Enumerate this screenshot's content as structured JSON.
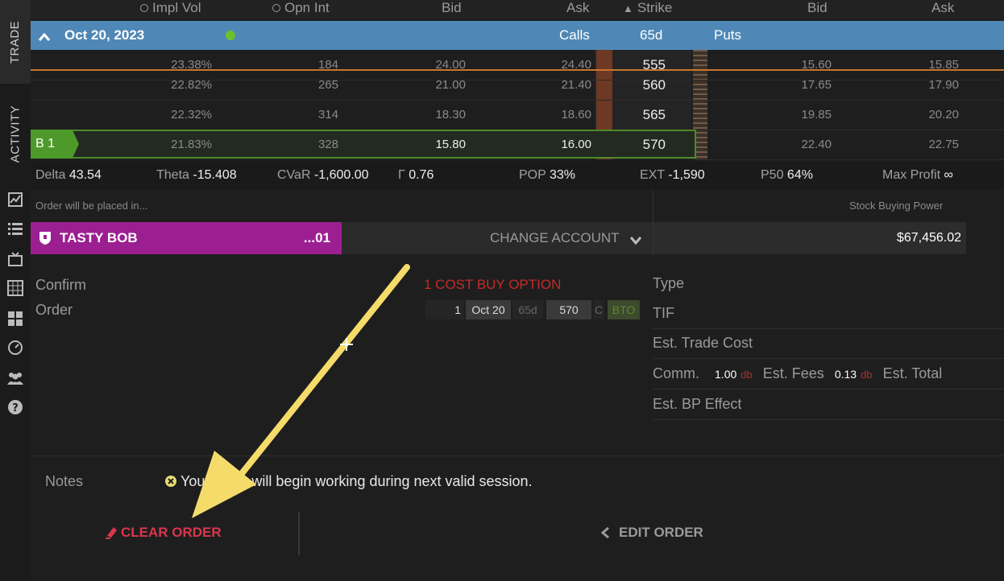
{
  "sidebar": {
    "tabs": [
      {
        "label": "TRADE"
      },
      {
        "label": "ACTIVITY"
      }
    ],
    "icons": [
      "chart-icon",
      "list-icon",
      "tv-icon",
      "grid-calendar-icon",
      "tiles-icon",
      "gauge-icon",
      "users-icon",
      "help-icon"
    ]
  },
  "chain": {
    "headers": {
      "impl_vol": "Impl Vol",
      "opn_int": "Opn Int",
      "bid": "Bid",
      "ask": "Ask",
      "strike": "Strike",
      "put_bid": "Bid",
      "put_ask": "Ask"
    },
    "expiration": {
      "date": "Oct 20, 2023",
      "calls": "Calls",
      "dte": "65d",
      "puts": "Puts"
    },
    "rows": [
      {
        "label": "",
        "iv": "23.38%",
        "oi": "184",
        "bid": "24.00",
        "ask": "24.40",
        "strike": "555",
        "put_bid": "15.60",
        "put_ask": "15.85"
      },
      {
        "label": "",
        "iv": "22.82%",
        "oi": "265",
        "bid": "21.00",
        "ask": "21.40",
        "strike": "560",
        "put_bid": "17.65",
        "put_ask": "17.90"
      },
      {
        "label": "",
        "iv": "22.32%",
        "oi": "314",
        "bid": "18.30",
        "ask": "18.60",
        "strike": "565",
        "put_bid": "19.85",
        "put_ask": "20.20"
      },
      {
        "label": "B 1",
        "iv": "21.83%",
        "oi": "328",
        "bid": "15.80",
        "ask": "16.00",
        "strike": "570",
        "put_bid": "22.40",
        "put_ask": "22.75"
      }
    ]
  },
  "stats": {
    "delta_label": "Delta",
    "delta": "43.54",
    "theta_label": "Theta",
    "theta": "-15.408",
    "cvar_label": "CVaR",
    "cvar": "-1,600.00",
    "gamma_label": "Γ",
    "gamma": "0.76",
    "pop_label": "POP",
    "pop": "33%",
    "ext_label": "EXT",
    "ext": "-1,590",
    "p50_label": "P50",
    "p50": "64%",
    "maxprofit_label": "Max Profit",
    "maxprofit": "∞"
  },
  "account": {
    "placed_in": "Order will be placed in...",
    "buying_power_label": "Stock Buying Power",
    "name": "TASTY BOB",
    "number": "...01",
    "change": "CHANGE ACCOUNT",
    "buying_power": "$67,456.02"
  },
  "order": {
    "confirm": "Confirm",
    "order_label": "Order",
    "title": "1 COST BUY OPTION",
    "leg": {
      "qty": "1",
      "exp": "Oct 20",
      "dte": "65d",
      "strike": "570",
      "type": "C",
      "action": "BTO"
    },
    "type_label": "Type",
    "tif_label": "TIF",
    "trade_cost_label": "Est. Trade Cost",
    "comm_label": "Comm.",
    "comm": "1.00",
    "comm_dir": "db",
    "fees_label": "Est. Fees",
    "fees": "0.13",
    "fees_dir": "db",
    "total_label": "Est. Total",
    "bp_effect_label": "Est. BP Effect"
  },
  "notes": {
    "label": "Notes",
    "message": "Your order will begin working during next valid session."
  },
  "actions": {
    "clear": "CLEAR ORDER",
    "edit": "EDIT ORDER"
  },
  "colors": {
    "expiration_bar": "#4f88b6",
    "account": "#9c1f92",
    "clear": "#d9364d",
    "annotation_arrow": "#f5dc6a"
  }
}
